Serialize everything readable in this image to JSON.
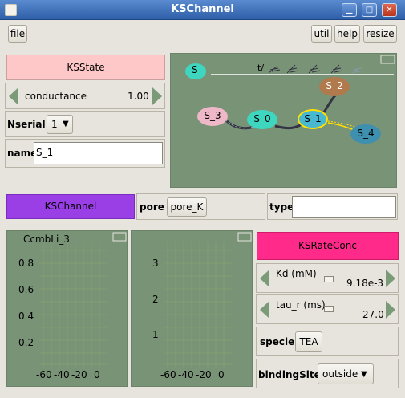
{
  "window": {
    "title": "KSChannel"
  },
  "toolbar": {
    "file": "file",
    "util": "util",
    "help": "help",
    "resize": "resize"
  },
  "ksstate": {
    "header": "KSState",
    "conductance_label": "conductance",
    "conductance_value": "1.00",
    "nserial_label": "Nserial",
    "nserial_value": "1",
    "name_label": "name",
    "name_value": "S_1"
  },
  "diagram": {
    "legend_state": "S",
    "rate_label": "t/",
    "states": [
      "S_0",
      "S_1",
      "S_2",
      "S_3",
      "S_4"
    ]
  },
  "kschannel": {
    "header": "KSChannel",
    "pore_label": "pore",
    "pore_value": "pore_K",
    "type_label": "type",
    "type_value": ""
  },
  "plot1": {
    "title": "CcmbLi_3",
    "yticks": [
      "0.8",
      "0.6",
      "0.4",
      "0.2"
    ],
    "xticks": [
      "-60",
      "-40",
      "-20",
      "0"
    ]
  },
  "plot2": {
    "yticks": [
      "3",
      "2",
      "1"
    ],
    "xticks": [
      "-60",
      "-40",
      "-20",
      "0"
    ]
  },
  "rate": {
    "header": "KSRateConc",
    "kd_label": "Kd (mM)",
    "kd_value": "9.18e-3",
    "tau_label": "tau_r (ms)",
    "tau_value": "27.0",
    "specie_label": "specie",
    "specie_value": "TEA",
    "binding_label": "bindingSite",
    "binding_value": "outside"
  },
  "colors": {
    "ksstate_header": "#ffc8c8",
    "kschannel_header": "#9a3fe6",
    "rate_header": "#ff2a8a",
    "diagram_bg": "#799377",
    "state_S0": "#3fd6c0",
    "state_S1": "#48b8d0",
    "state_S2": "#b07a4c",
    "state_S3": "#efb8c8",
    "state_S4": "#3f8fae"
  }
}
